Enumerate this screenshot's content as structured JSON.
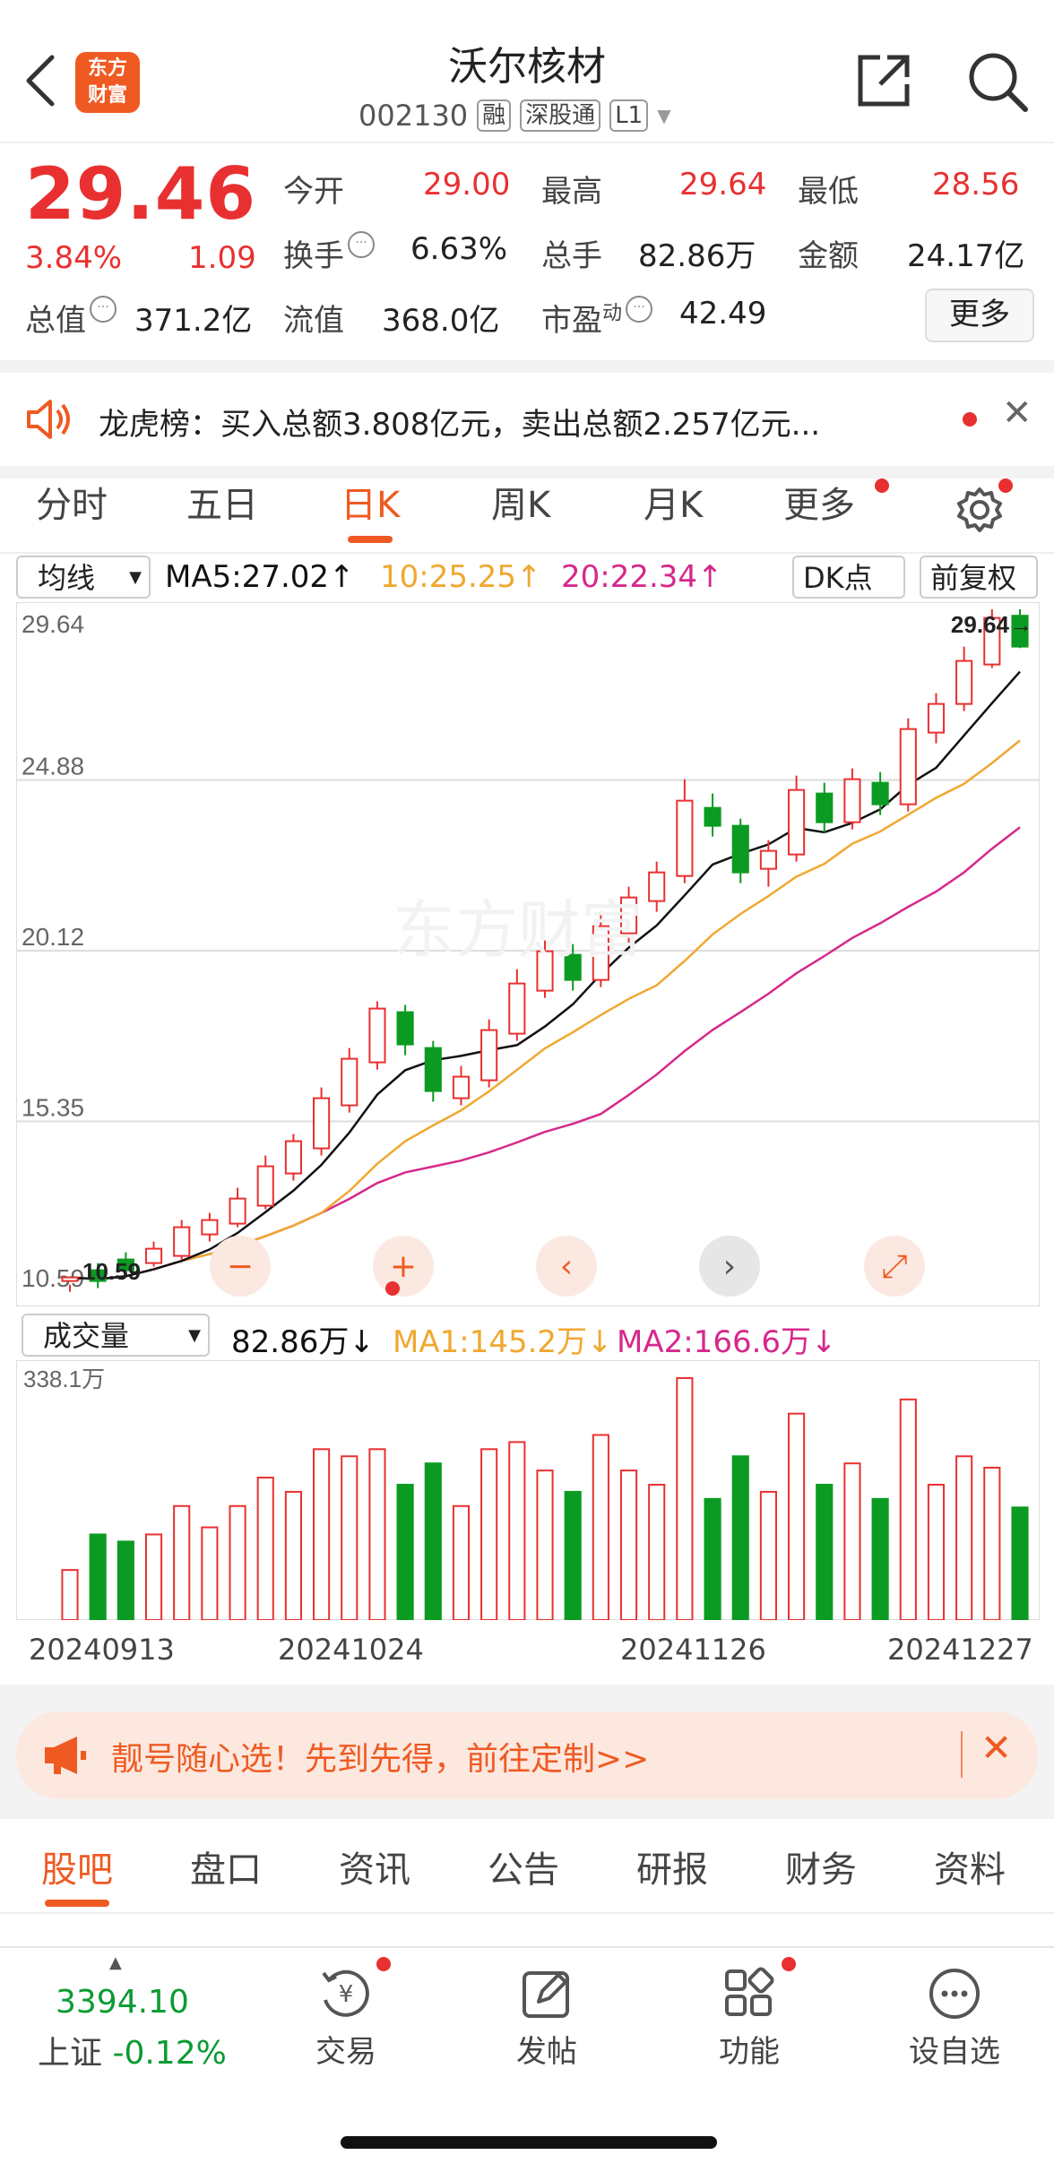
{
  "header": {
    "title": "沃尔核材",
    "code": "002130",
    "tags": [
      "融",
      "深股通",
      "L1"
    ],
    "logo_line1": "东方",
    "logo_line2": "财富"
  },
  "quote": {
    "price": "29.46",
    "change_pct": "3.84%",
    "change": "1.09",
    "open_label": "今开",
    "open": "29.00",
    "high_label": "最高",
    "high": "29.64",
    "low_label": "最低",
    "low": "28.56",
    "turnover_label": "换手",
    "turnover": "6.63%",
    "volume_label": "总手",
    "volume": "82.86万",
    "amount_label": "金额",
    "amount": "24.17亿",
    "mktcap_label": "总值",
    "mktcap": "371.2亿",
    "float_label": "流值",
    "float": "368.0亿",
    "pe_label": "市盈",
    "pe_sup": "动",
    "pe": "42.49",
    "more": "更多"
  },
  "notice": {
    "text": "龙虎榜：买入总额3.808亿元，卖出总额2.257亿元..."
  },
  "period_tabs": [
    "分时",
    "五日",
    "日K",
    "周K",
    "月K",
    "更多"
  ],
  "active_period": "日K",
  "ma_bar": {
    "selector": "均线",
    "ma5": "MA5:27.02↑",
    "ma10": "10:25.25↑",
    "ma20": "20:22.34↑",
    "dk": "DK点",
    "adjust": "前复权"
  },
  "vol_bar": {
    "selector": "成交量",
    "vol": "82.86万↓",
    "ma1": "MA1:145.2万↓",
    "ma2": "MA2:166.6万↓"
  },
  "colors": {
    "up": "#e93030",
    "down": "#0c9b22",
    "ma5": "#111111",
    "ma10": "#f0a830",
    "ma20": "#d6288c",
    "accent": "#ef5a22"
  },
  "chart_data": {
    "type": "candlestick",
    "y_axis_labels": [
      "29.64",
      "24.88",
      "20.12",
      "15.35",
      "10.59"
    ],
    "ylim": [
      10.59,
      29.64
    ],
    "max_label": "29.64→",
    "min_label": "10.59",
    "x_labels": [
      "20240913",
      "20241024",
      "20241126",
      "20241227"
    ],
    "candles": [
      [
        10.9,
        11.0,
        10.8,
        10.6
      ],
      [
        11.2,
        10.9,
        10.7,
        11.4
      ],
      [
        11.5,
        11.2,
        11.1,
        11.7
      ],
      [
        11.4,
        11.8,
        11.3,
        12.0
      ],
      [
        11.6,
        12.4,
        11.5,
        12.6
      ],
      [
        12.2,
        12.6,
        12.0,
        12.8
      ],
      [
        12.5,
        13.2,
        12.4,
        13.5
      ],
      [
        13.0,
        14.1,
        12.9,
        14.4
      ],
      [
        13.9,
        14.8,
        13.7,
        15.0
      ],
      [
        14.6,
        16.0,
        14.4,
        16.3
      ],
      [
        15.8,
        17.1,
        15.6,
        17.4
      ],
      [
        17.0,
        18.5,
        16.8,
        18.7
      ],
      [
        18.4,
        17.5,
        17.2,
        18.6
      ],
      [
        17.4,
        16.2,
        15.9,
        17.6
      ],
      [
        16.0,
        16.6,
        15.8,
        16.9
      ],
      [
        16.5,
        17.9,
        16.3,
        18.2
      ],
      [
        17.8,
        19.2,
        17.6,
        19.6
      ],
      [
        19.0,
        20.1,
        18.8,
        20.4
      ],
      [
        20.0,
        19.3,
        19.0,
        20.3
      ],
      [
        19.3,
        20.8,
        19.1,
        21.2
      ],
      [
        20.6,
        21.6,
        20.3,
        21.9
      ],
      [
        21.5,
        22.3,
        21.2,
        22.6
      ],
      [
        22.2,
        24.3,
        22.0,
        24.9
      ],
      [
        24.1,
        23.6,
        23.3,
        24.5
      ],
      [
        23.6,
        22.3,
        22.0,
        23.8
      ],
      [
        22.4,
        22.9,
        21.9,
        23.2
      ],
      [
        22.8,
        24.6,
        22.6,
        25.0
      ],
      [
        24.5,
        23.7,
        23.4,
        24.8
      ],
      [
        23.7,
        24.9,
        23.5,
        25.2
      ],
      [
        24.8,
        24.2,
        23.9,
        25.1
      ],
      [
        24.2,
        26.3,
        24.0,
        26.6
      ],
      [
        26.2,
        27.0,
        25.9,
        27.3
      ],
      [
        27.0,
        28.2,
        26.8,
        28.6
      ],
      [
        28.1,
        29.4,
        28.0,
        29.64
      ],
      [
        29.46,
        28.6,
        28.56,
        29.64
      ]
    ],
    "ma5": [],
    "ma10": [],
    "ma20": [],
    "volume_max_label": "338.1万",
    "volumes": []
  },
  "nav_controls": [
    "−",
    "+",
    "<",
    ">",
    "expand"
  ],
  "banner": {
    "text": "靓号随心选！先到先得，前往定制>>"
  },
  "info_tabs": [
    "股吧",
    "盘口",
    "资讯",
    "公告",
    "研报",
    "财务",
    "资料"
  ],
  "bottom_nav": {
    "index_value": "3394.10",
    "index_name": "上证",
    "index_change": "-0.12%",
    "items": [
      "交易",
      "发帖",
      "功能",
      "设自选"
    ]
  }
}
